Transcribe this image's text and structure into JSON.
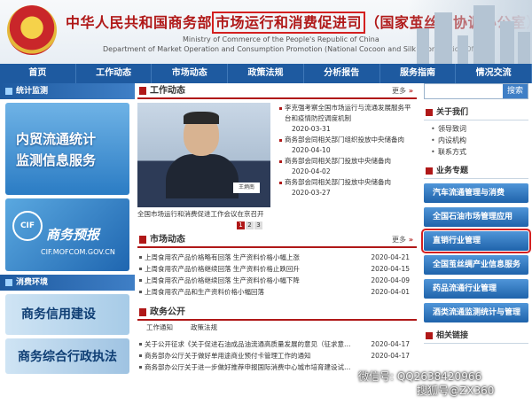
{
  "header": {
    "title_part1": "中华人民共和国商务部",
    "title_part2": "市场运行和消费促进司",
    "title_part3": "（国家茧丝绸协调办公室）",
    "english_line1": "Ministry of Commerce of the People's Republic of China",
    "english_line2": "Department of Market Operation and Consumption Promotion (National Cocoon and Silk Coordination Office)"
  },
  "nav": [
    "首页",
    "工作动态",
    "市场动态",
    "政策法规",
    "分析报告",
    "服务指南",
    "情况交流"
  ],
  "left": {
    "section1": "统计监测",
    "banner_stats_line1": "内贸流通统计",
    "banner_stats_line2": "监测信息服务",
    "banner_forecast_logo": "CIF",
    "banner_forecast_title": "商务预报",
    "banner_forecast_url": "CIF.MOFCOM.GOV.CN",
    "section2": "消费环境",
    "banner_credit": "商务信用建设",
    "banner_law": "商务综合行政执法"
  },
  "work": {
    "title": "工作动态",
    "more": "更多",
    "photo_caption": "全国市场运行和消费促进工作会议在京召开",
    "photo_tag": "王炳南",
    "pager": [
      "1",
      "2",
      "3"
    ],
    "news": [
      {
        "text": "李克强考察全国市场运行与流通发展服务平台和疫情防控调度机制",
        "date": "2020-03-31"
      },
      {
        "text": "商务部会同相关部门组织投放中央储备肉",
        "date": "2020-04-10"
      },
      {
        "text": "商务部会同相关部门投放中央储备肉",
        "date": "2020-04-02"
      },
      {
        "text": "商务部会同相关部门投放中央储备肉",
        "date": "2020-03-27"
      }
    ]
  },
  "market": {
    "title": "市场动态",
    "more": "更多",
    "rows": [
      {
        "text": "上周食用农产品价格略有回落 生产资料价格小幅上涨",
        "date": "2020-04-21"
      },
      {
        "text": "上周食用农产品价格继续回落 生产资料价格止跌回升",
        "date": "2020-04-15"
      },
      {
        "text": "上周食用农产品价格继续回落 生产资料价格小幅下降",
        "date": "2020-04-09"
      },
      {
        "text": "上周食用农产品和生产资料价格小幅回落",
        "date": "2020-04-01"
      }
    ]
  },
  "gov": {
    "title": "政务公开",
    "tab1": "工作通知",
    "tab2": "政策法规",
    "rows": [
      {
        "text": "关于公开征求《关于促进石油成品油流通高质量发展的意见（征求意…",
        "date": "2020-04-17"
      },
      {
        "text": "商务部办公厅关于做好单用途商业预付卡管理工作的通知",
        "date": "2020-04-17"
      },
      {
        "text": "商务部办公厅关于进一步做好推荐申报国际消费中心城市培育建设试…",
        "date": ""
      }
    ]
  },
  "right": {
    "search_button": "搜索",
    "about_title": "关于我们",
    "about_items": [
      "领导致词",
      "内设机构",
      "联系方式"
    ],
    "business_title": "业务专题",
    "buttons": [
      "汽车流通管理与消费",
      "全国石油市场管理应用",
      "直销行业管理",
      "全国茧丝绸产业信息服务",
      "药品流通行业管理",
      "酒类流通监测统计与管理"
    ],
    "bottom_title": "相关链接"
  },
  "watermark": {
    "line1": "微信号: QQ2638420966",
    "line2": "搜狐号@ZX360"
  },
  "colors": {
    "nav_blue": "#1e5aa0",
    "title_red": "#b01818",
    "highlight_box": "#d42020"
  }
}
